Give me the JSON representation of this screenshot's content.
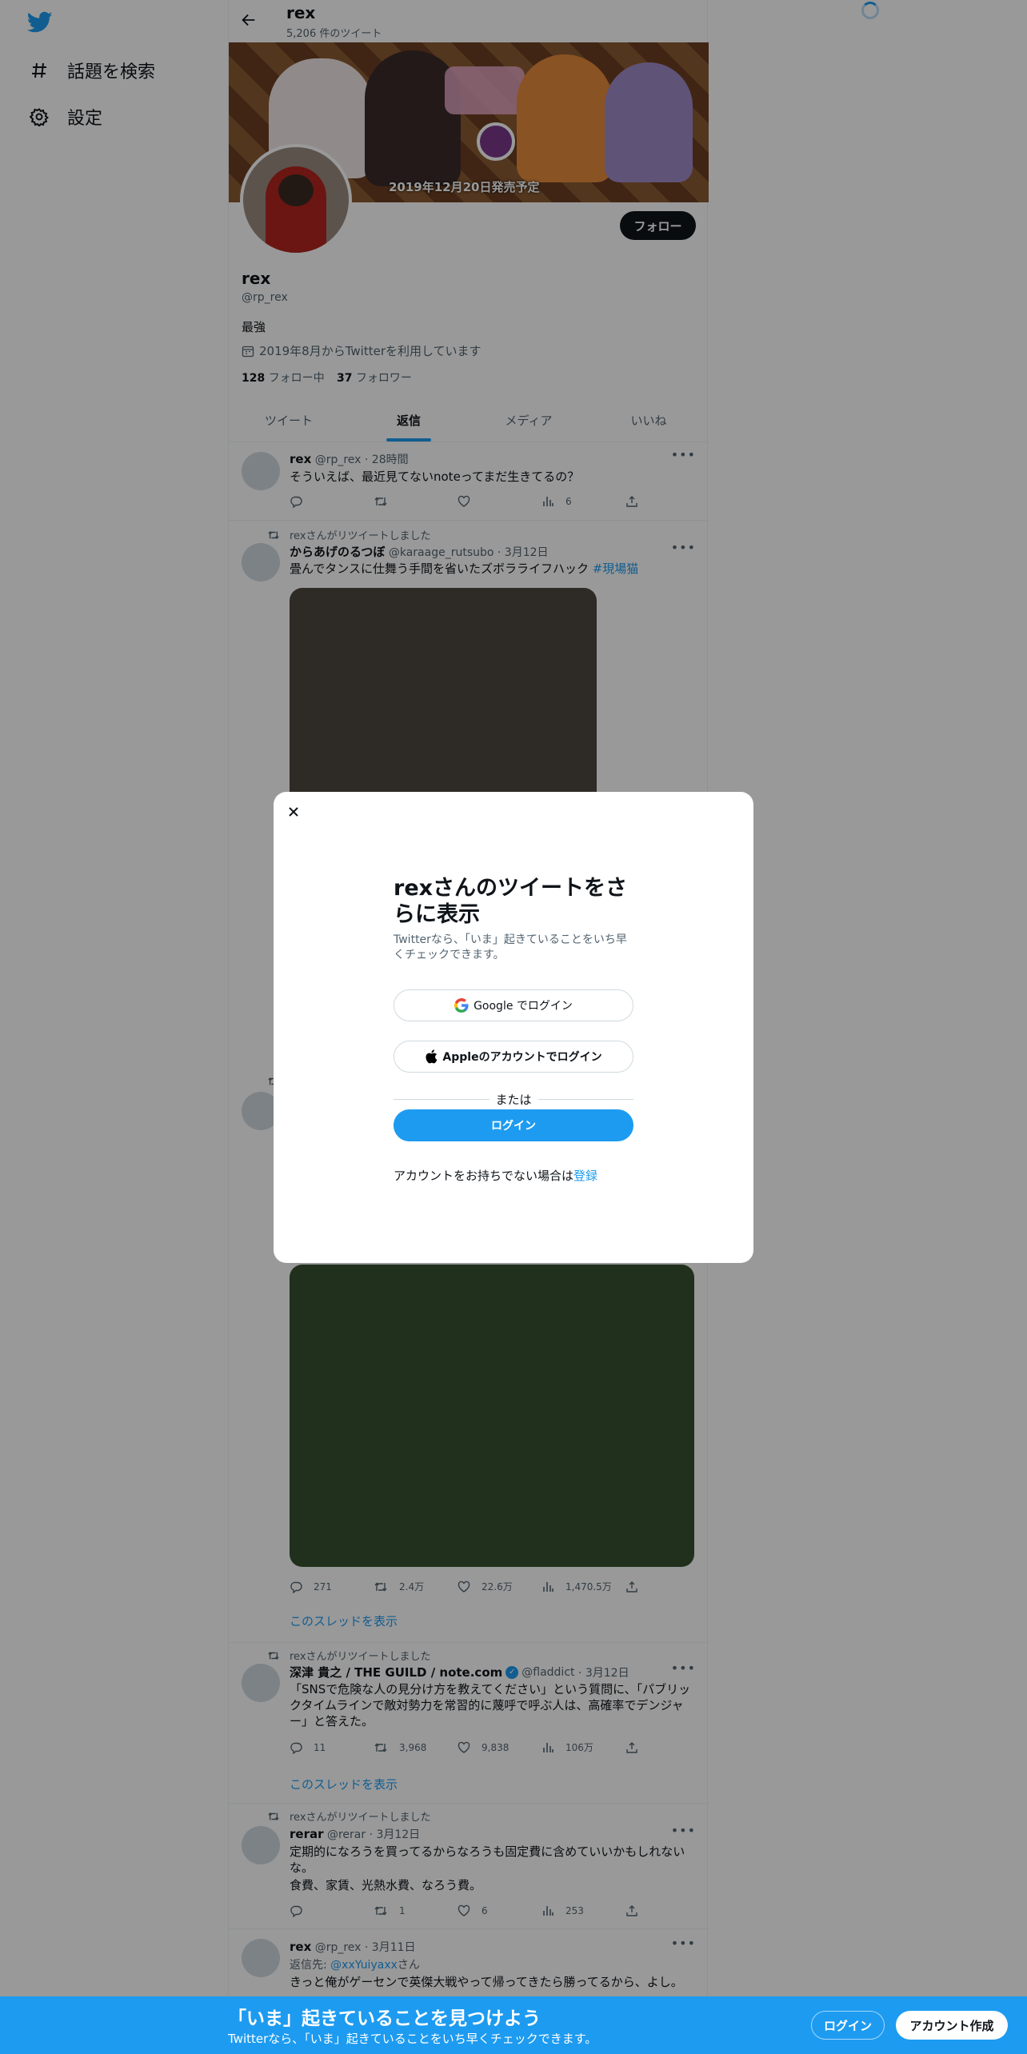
{
  "nav": {
    "explore": "話題を検索",
    "settings": "設定"
  },
  "header": {
    "title": "rex",
    "subtitle": "5,206 件のツイート"
  },
  "banner": {
    "caption": "2019年12月20日発売予定"
  },
  "profile": {
    "name": "rex",
    "handle": "@rp_rex",
    "bio": "最強",
    "joined": "2019年8月からTwitterを利用しています",
    "following_count": "128",
    "following_label": "フォロー中",
    "followers_count": "37",
    "followers_label": "フォロワー",
    "follow_button": "フォロー"
  },
  "tabs": [
    {
      "label": "ツイート",
      "active": false
    },
    {
      "label": "返信",
      "active": true
    },
    {
      "label": "メディア",
      "active": false
    },
    {
      "label": "いいね",
      "active": false
    }
  ],
  "tweets": {
    "t1": {
      "name": "rex",
      "handle": "@rp_rex",
      "time": "· 28時間",
      "text": "そういえば、最近見てないnoteってまだ生きてるの？",
      "views": "6"
    },
    "t2": {
      "retweeted_by": "rexさんがリツイートしました",
      "name": "からあげのるつぼ",
      "handle": "@karaage_rutsubo",
      "time": "· 3月12日",
      "text": "畳んでタンスに仕舞う手間を省いたズボラライフハック",
      "hashtag": "#現場猫",
      "media_color": "#4d473f"
    },
    "t3": {
      "media_color": "#37502f",
      "replies": "271",
      "retweets": "2.4万",
      "likes": "22.6万",
      "views": "1,470.5万",
      "thread": "このスレッドを表示"
    },
    "t4": {
      "retweeted_by": "rexさんがリツイートしました",
      "name": "深津 貴之 / THE GUILD / note.com",
      "handle": "@fladdict",
      "time": "· 3月12日",
      "text": "「SNSで危険な人の見分け方を教えてください」という質問に、「パブリックタイムラインで敵対勢力を常習的に蔑呼で呼ぶ人は、高確率でデンジャー」と答えた。",
      "replies": "11",
      "retweets": "3,968",
      "likes": "9,838",
      "views": "106万",
      "thread": "このスレッドを表示"
    },
    "t5": {
      "retweeted_by": "rexさんがリツイートしました",
      "name": "rerar",
      "handle": "@rerar",
      "time": "· 3月12日",
      "text1": "定期的になろうを買ってるからなろうも固定費に含めていいかもしれないな。",
      "text2": "食費、家賃、光熱水費、なろう費。",
      "retweets": "1",
      "likes": "6",
      "views": "253"
    },
    "t6": {
      "name": "rex",
      "handle": "@rp_rex",
      "time": "· 3月11日",
      "reply_to_label": "返信先:",
      "reply_to_handle": "@xxYuiyaxx",
      "reply_to_suffix": "さん",
      "text": "きっと俺がゲーセンで英傑大戦やって帰ってきたら勝ってるから、よし。"
    }
  },
  "modal": {
    "title": "rexさんのツイートをさらに表示",
    "subtitle": "Twitterなら、「いま」起きていることをいち早くチェックできます。",
    "google_button": "Google でログイン",
    "apple_button": "Appleのアカウントでログイン",
    "or": "または",
    "login_button": "ログイン",
    "signup_prompt": "アカウントをお持ちでない場合は",
    "signup_link": "登録"
  },
  "bottom_bar": {
    "title": "「いま」起きていることを見つけよう",
    "subtitle": "Twitterなら、「いま」起きていることをいち早くチェックできます。",
    "login": "ログイン",
    "signup": "アカウント作成"
  },
  "colors": {
    "accent": "#1d9bf0",
    "overlay": "rgba(0,0,0,0.4)"
  }
}
